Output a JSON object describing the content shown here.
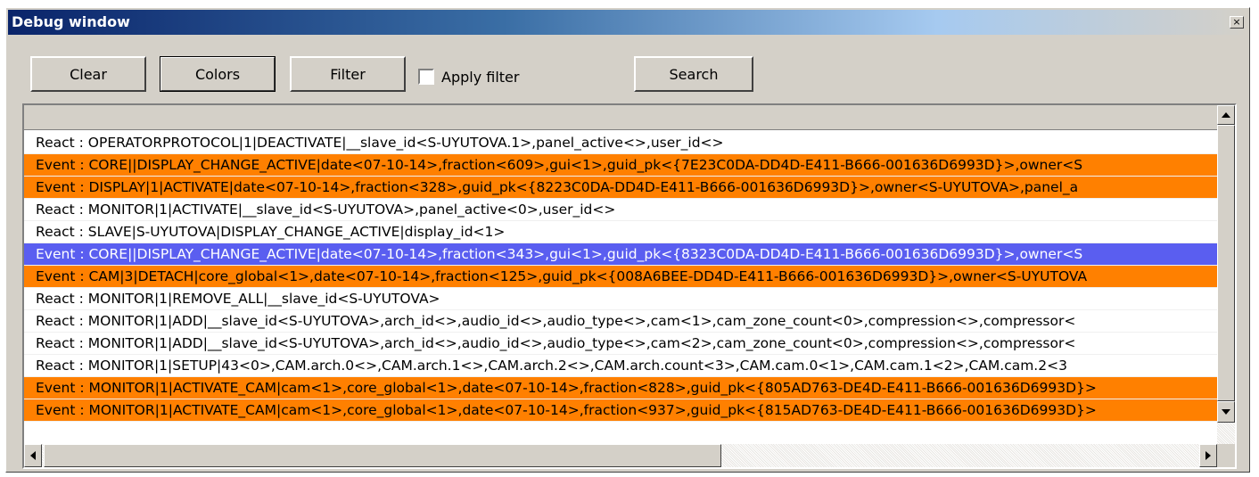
{
  "window": {
    "title": "Debug window",
    "close_glyph": "×"
  },
  "toolbar": {
    "clear_label": "Clear",
    "colors_label": "Colors",
    "filter_label": "Filter",
    "apply_filter_label": "Apply filter",
    "apply_filter_checked": false,
    "search_label": "Search"
  },
  "log": {
    "rows": [
      {
        "type": "react",
        "text": "React : OPERATORPROTOCOL|1|DEACTIVATE|__slave_id<S-UYUTOVA.1>,panel_active<>,user_id<>"
      },
      {
        "type": "event",
        "text": "Event : CORE||DISPLAY_CHANGE_ACTIVE|date<07-10-14>,fraction<609>,gui<1>,guid_pk<{7E23C0DA-DD4D-E411-B666-001636D6993D}>,owner<S"
      },
      {
        "type": "event",
        "text": "Event : DISPLAY|1|ACTIVATE|date<07-10-14>,fraction<328>,guid_pk<{8223C0DA-DD4D-E411-B666-001636D6993D}>,owner<S-UYUTOVA>,panel_a"
      },
      {
        "type": "react",
        "text": "React : MONITOR|1|ACTIVATE|__slave_id<S-UYUTOVA>,panel_active<0>,user_id<>"
      },
      {
        "type": "react",
        "text": "React : SLAVE|S-UYUTOVA|DISPLAY_CHANGE_ACTIVE|display_id<1>"
      },
      {
        "type": "selected",
        "text": "Event : CORE||DISPLAY_CHANGE_ACTIVE|date<07-10-14>,fraction<343>,gui<1>,guid_pk<{8323C0DA-DD4D-E411-B666-001636D6993D}>,owner<S"
      },
      {
        "type": "event",
        "text": "Event : CAM|3|DETACH|core_global<1>,date<07-10-14>,fraction<125>,guid_pk<{008A6BEE-DD4D-E411-B666-001636D6993D}>,owner<S-UYUTOVA"
      },
      {
        "type": "react",
        "text": "React : MONITOR|1|REMOVE_ALL|__slave_id<S-UYUTOVA>"
      },
      {
        "type": "react",
        "text": "React : MONITOR|1|ADD|__slave_id<S-UYUTOVA>,arch_id<>,audio_id<>,audio_type<>,cam<1>,cam_zone_count<0>,compression<>,compressor<"
      },
      {
        "type": "react",
        "text": "React : MONITOR|1|ADD|__slave_id<S-UYUTOVA>,arch_id<>,audio_id<>,audio_type<>,cam<2>,cam_zone_count<0>,compression<>,compressor<"
      },
      {
        "type": "react",
        "text": "React : MONITOR|1|SETUP|43<0>,CAM.arch.0<>,CAM.arch.1<>,CAM.arch.2<>,CAM.arch.count<3>,CAM.cam.0<1>,CAM.cam.1<2>,CAM.cam.2<3"
      },
      {
        "type": "event",
        "text": "Event : MONITOR|1|ACTIVATE_CAM|cam<1>,core_global<1>,date<07-10-14>,fraction<828>,guid_pk<{805AD763-DE4D-E411-B666-001636D6993D}>"
      },
      {
        "type": "event",
        "text": "Event : MONITOR|1|ACTIVATE_CAM|cam<1>,core_global<1>,date<07-10-14>,fraction<937>,guid_pk<{815AD763-DE4D-E411-B666-001636D6993D}>"
      }
    ]
  },
  "colors": {
    "event_row": "#ff8000",
    "selected_row": "#5a5ef0",
    "title_bar": "#0a246a",
    "window_face": "#d4d0c8"
  }
}
